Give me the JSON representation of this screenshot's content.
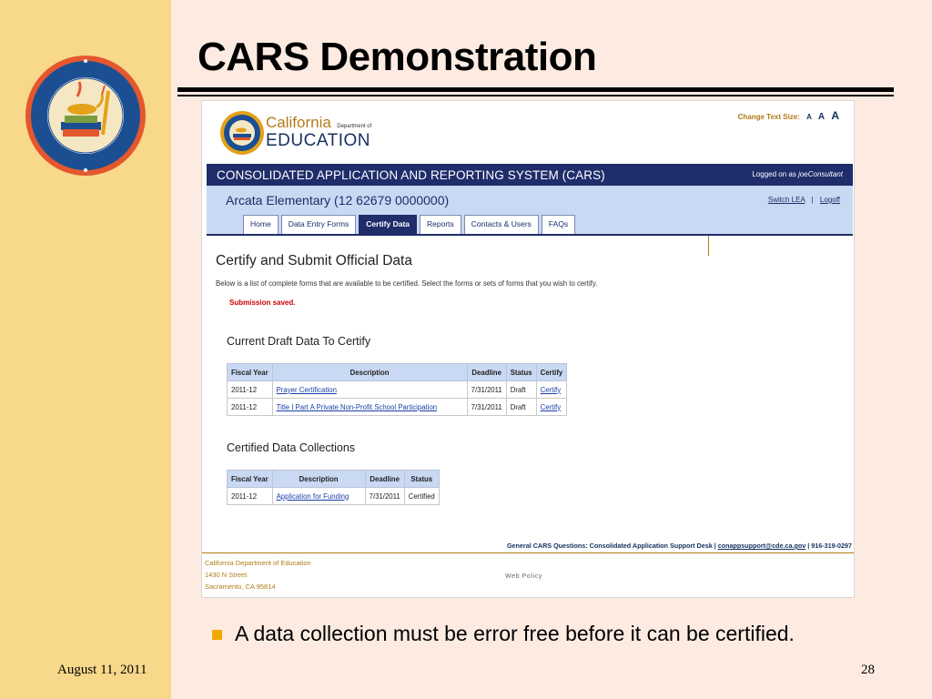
{
  "slide": {
    "title": "CARS Demonstration",
    "bullet": "A data collection must be error free before it can be certified.",
    "date": "August 11, 2011",
    "page_number": "28"
  },
  "colors": {
    "left_band": "#f8d88a",
    "slide_bg": "#fdebe2",
    "header_navy": "#1f2d6b",
    "lea_bar": "#c9d9f3",
    "accent_gold": "#b27b17",
    "error_red": "#cc0000",
    "bullet": "#f2a900"
  },
  "header": {
    "brand_california": "California",
    "brand_department": "Department of",
    "brand_education": "EDUCATION",
    "change_text_size_label": "Change Text Size:",
    "text_size_options": [
      "A",
      "A",
      "A"
    ]
  },
  "system_bar": {
    "title": "CONSOLIDATED APPLICATION AND REPORTING SYSTEM (CARS)",
    "logged_on_prefix": "Logged on as",
    "user": "joeConsultant"
  },
  "lea_bar": {
    "lea_name": "Arcata Elementary (12 62679 0000000)",
    "switch_lea": "Switch LEA",
    "separator": "|",
    "logoff": "Logoff"
  },
  "tabs": [
    {
      "label": "Home",
      "active": false
    },
    {
      "label": "Data Entry Forms",
      "active": false
    },
    {
      "label": "Certify Data",
      "active": true
    },
    {
      "label": "Reports",
      "active": false
    },
    {
      "label": "Contacts & Users",
      "active": false
    },
    {
      "label": "FAQs",
      "active": false
    }
  ],
  "main": {
    "heading": "Certify and Submit Official Data",
    "description": "Below is a list of complete forms that are available to be certified. Select the forms or sets of forms that you wish to certify.",
    "status_message": "Submission saved."
  },
  "draft_table": {
    "title": "Current Draft Data To Certify",
    "headers": [
      "Fiscal Year",
      "Description",
      "Deadline",
      "Status",
      "Certify"
    ],
    "rows": [
      [
        "2011-12",
        "Prayer Certification",
        "7/31/2011",
        "Draft",
        "Certify"
      ],
      [
        "2011-12",
        "Title I Part A Private Non-Profit School Participation",
        "7/31/2011",
        "Draft",
        "Certify"
      ]
    ]
  },
  "certified_table": {
    "title": "Certified Data Collections",
    "headers": [
      "Fiscal Year",
      "Description",
      "Deadline",
      "Status"
    ],
    "rows": [
      [
        "2011-12",
        "Application for Funding",
        "7/31/2011",
        "Certified"
      ]
    ]
  },
  "footer": {
    "help_label": "General CARS Questions:",
    "help_desk": "Consolidated Application Support Desk",
    "help_email": "conappsupport@cde.ca.gov",
    "help_phone": "916-319-0297",
    "address_lines": [
      "California Department of Education",
      "1430 N Street",
      "Sacramento, CA 95814"
    ],
    "web_policy": "Web Policy"
  }
}
